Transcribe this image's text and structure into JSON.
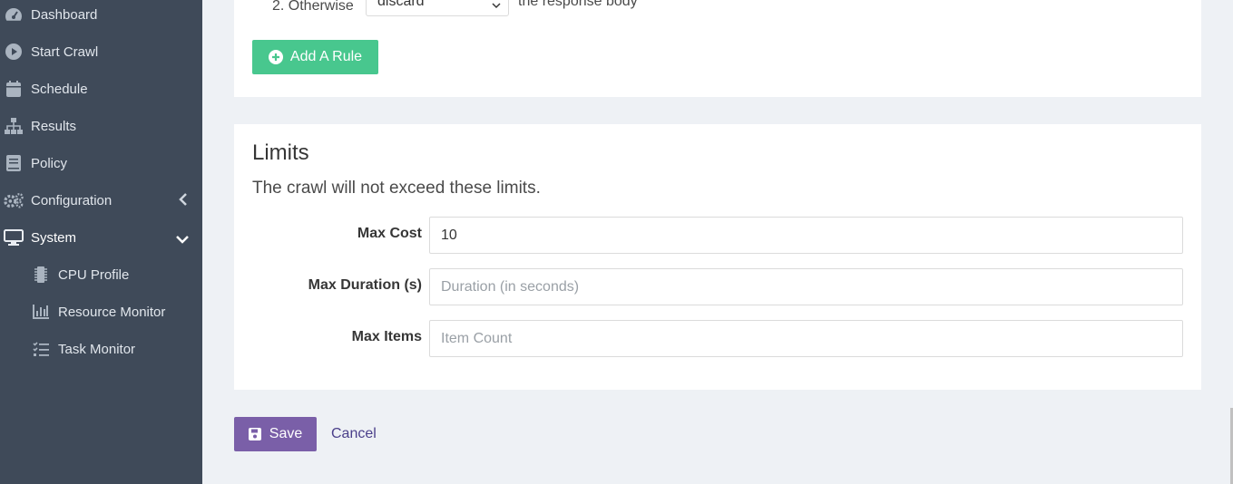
{
  "sidebar": {
    "items": [
      {
        "label": "Dashboard",
        "icon": "dashboard-icon"
      },
      {
        "label": "Start Crawl",
        "icon": "play-circle-icon"
      },
      {
        "label": "Schedule",
        "icon": "calendar-icon"
      },
      {
        "label": "Results",
        "icon": "sitemap-icon"
      },
      {
        "label": "Policy",
        "icon": "book-icon"
      },
      {
        "label": "Configuration",
        "icon": "cogs-icon"
      },
      {
        "label": "System",
        "icon": "desktop-icon"
      }
    ],
    "sub_items": [
      {
        "label": "CPU Profile",
        "icon": "microchip-icon"
      },
      {
        "label": "Resource Monitor",
        "icon": "chart-bar-icon"
      },
      {
        "label": "Task Monitor",
        "icon": "tasks-icon"
      }
    ]
  },
  "rules": {
    "row_prefix": "2. Otherwise",
    "select_value": "discard",
    "row_suffix": "the response body",
    "add_label": "Add A Rule"
  },
  "limits": {
    "title": "Limits",
    "subtitle": "The crawl will not exceed these limits.",
    "fields": [
      {
        "label": "Max Cost",
        "value": "10",
        "placeholder": ""
      },
      {
        "label": "Max Duration (s)",
        "value": "",
        "placeholder": "Duration (in seconds)"
      },
      {
        "label": "Max Items",
        "value": "",
        "placeholder": "Item Count"
      }
    ]
  },
  "actions": {
    "save_label": "Save",
    "cancel_label": "Cancel"
  },
  "colors": {
    "sidebar_bg": "#3f4a59",
    "add_button": "#48c78e",
    "save_button": "#7a5fa8",
    "page_bg": "#eef1f5"
  }
}
